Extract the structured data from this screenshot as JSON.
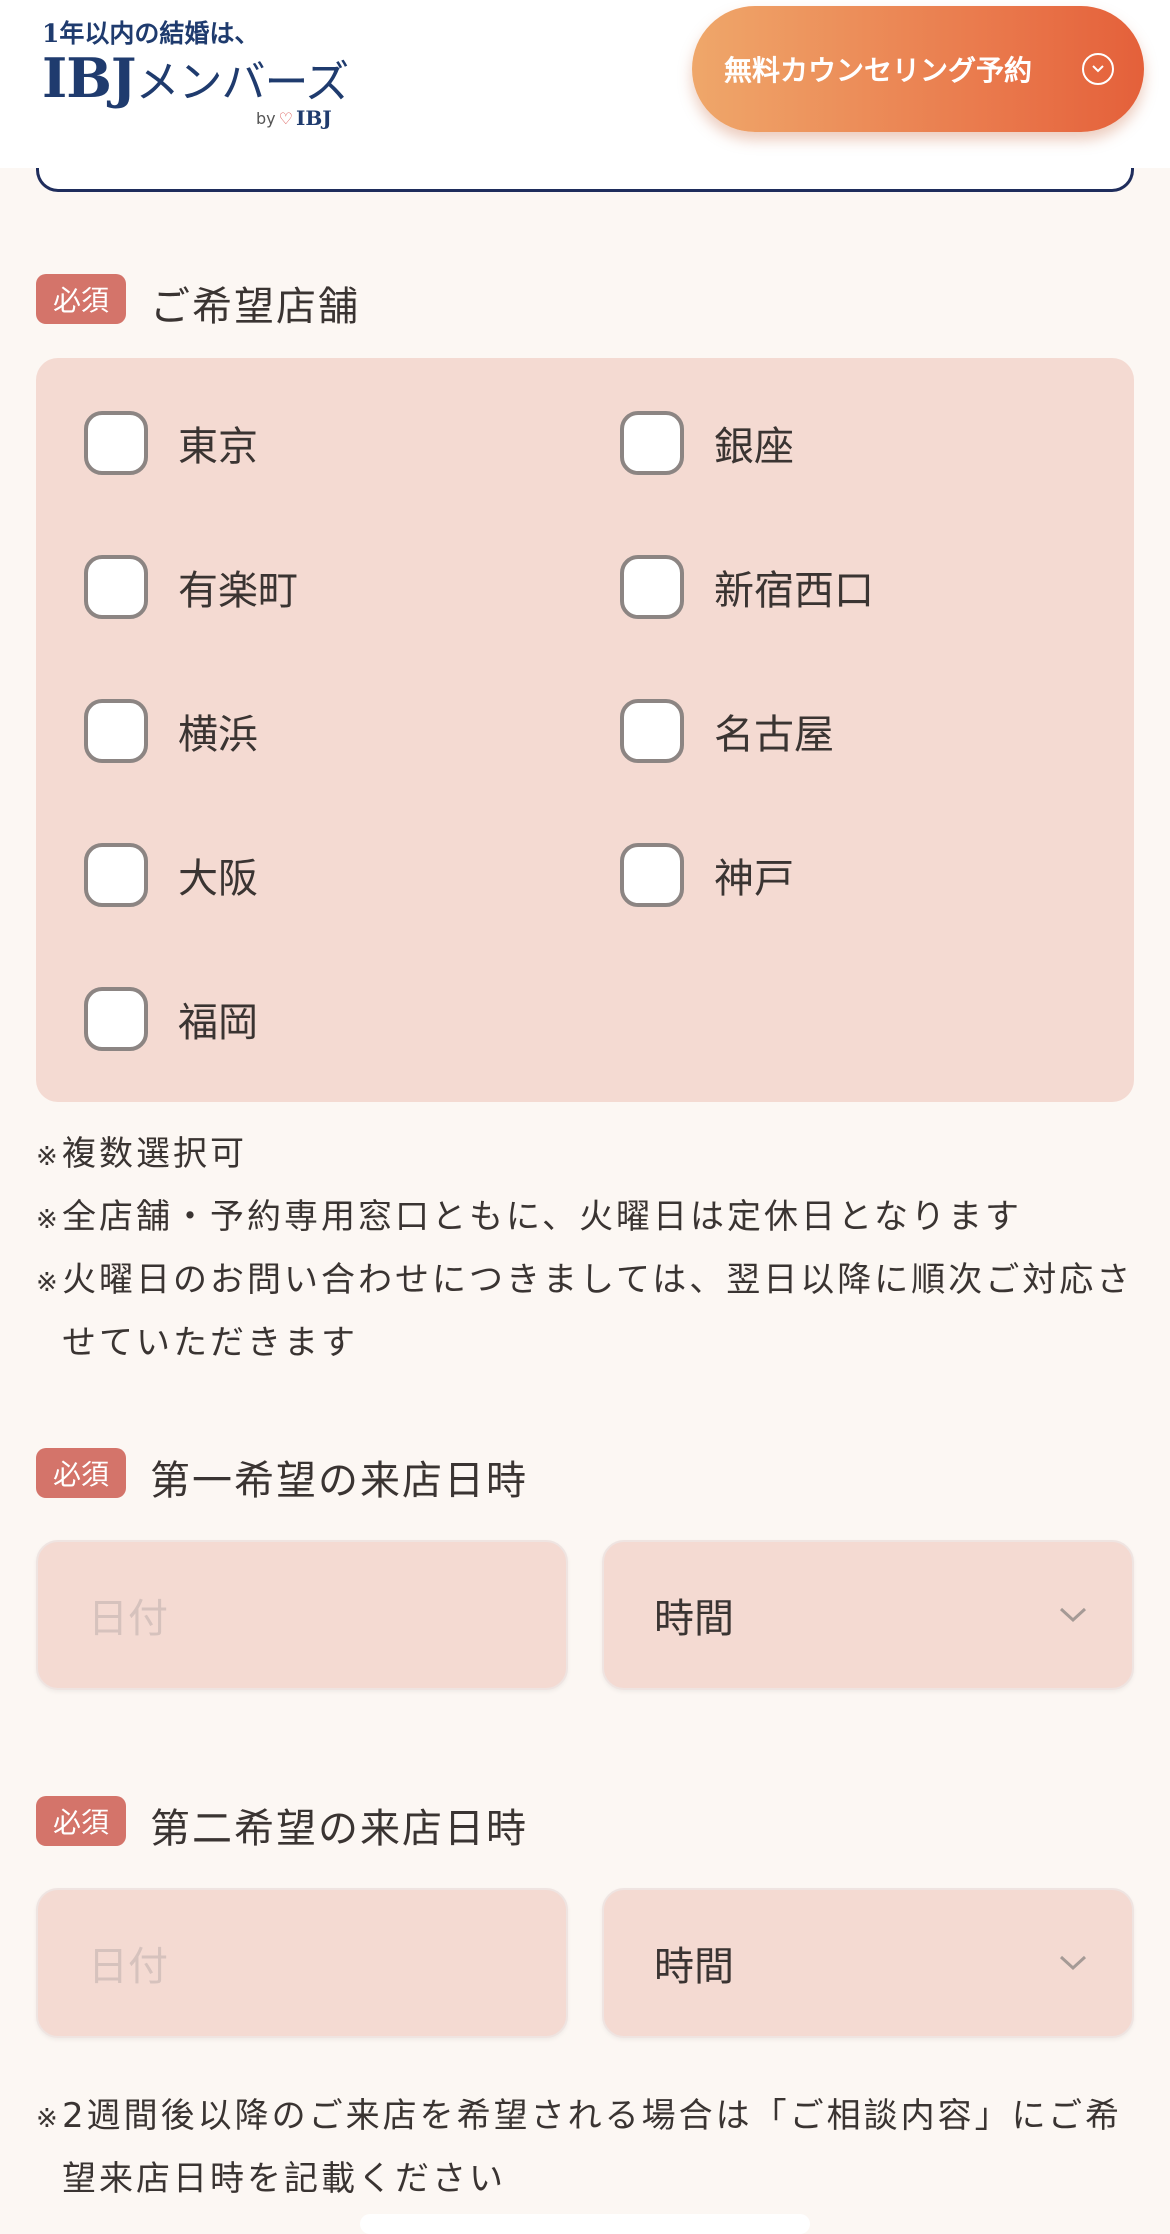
{
  "header": {
    "logo_tagline": "1年以内の結婚は、",
    "logo_brand": "IBJ",
    "logo_members": "メンバーズ",
    "logo_by": "by",
    "logo_by_brand": "IBJ",
    "cta_label": "無料カウンセリング予約",
    "cta_icon": "chevron-circle-down-icon"
  },
  "stores": {
    "required": "必須",
    "title": "ご希望店舗",
    "options": [
      "東京",
      "銀座",
      "有楽町",
      "新宿西口",
      "横浜",
      "名古屋",
      "大阪",
      "神戸",
      "福岡"
    ]
  },
  "notes": {
    "mark": "※",
    "lines": [
      "複数選択可",
      "全店舗・予約専用窓口ともに、火曜日は定休日となります",
      "火曜日のお問い合わせにつきましては、翌日以降に順次ご対応させていただきます"
    ]
  },
  "first_choice": {
    "required": "必須",
    "title": "第一希望の来店日時",
    "date_placeholder": "日付",
    "time_value": "時間"
  },
  "second_choice": {
    "required": "必須",
    "title": "第二希望の来店日時",
    "date_placeholder": "日付",
    "time_value": "時間"
  },
  "bottom_note": {
    "mark": "※",
    "text": "2週間後以降のご来店を希望される場合は「ご相談内容」にご希望来店日時を記載ください"
  },
  "colors": {
    "accent": "#d4746a",
    "field_bg": "#f4dad2",
    "cta_start": "#efa76a",
    "cta_end": "#e4603a",
    "brand_navy": "#1f3b6e"
  }
}
